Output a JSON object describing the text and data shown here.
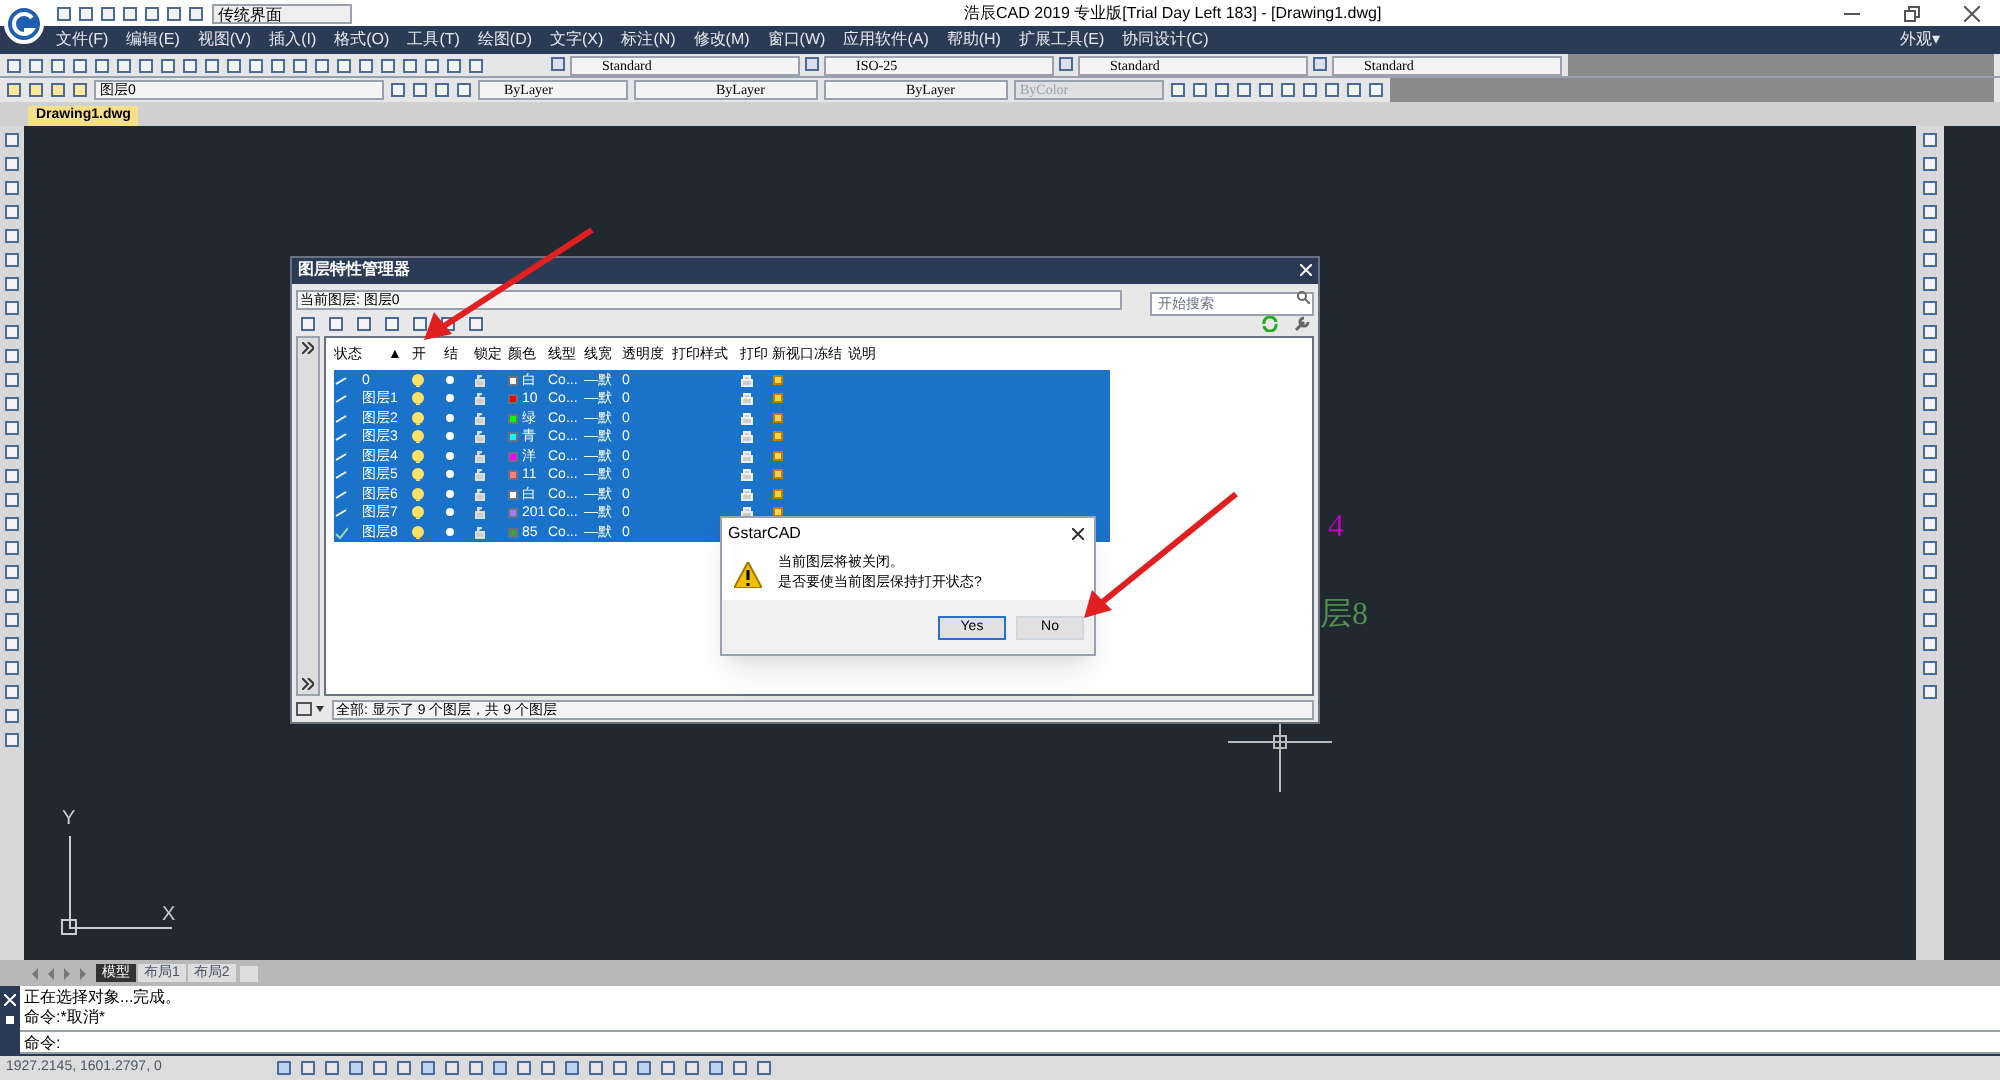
{
  "window": {
    "title": "浩辰CAD 2019 专业版[Trial Day Left 183] - [Drawing1.dwg]",
    "workspace": "传统界面",
    "appearance": "外观▾"
  },
  "menu": [
    "文件(F)",
    "编辑(E)",
    "视图(V)",
    "插入(I)",
    "格式(O)",
    "工具(T)",
    "绘图(D)",
    "文字(X)",
    "标注(N)",
    "修改(M)",
    "窗口(W)",
    "应用软件(A)",
    "帮助(H)",
    "扩展工具(E)",
    "协同设计(C)"
  ],
  "toolbar_dropdowns": [
    "Standard",
    "ISO-25",
    "Standard",
    "Standard"
  ],
  "properties_bar": {
    "layer": "图层0",
    "color_setting": "ByLayer",
    "linetype": "ByLayer",
    "lineweight": "ByLayer",
    "plotstyle": "ByColor"
  },
  "document_tabs": [
    {
      "label": "Drawing1.dwg",
      "selected": true
    }
  ],
  "canvas_texts": [
    {
      "text": "4",
      "color": "#c000c0"
    },
    {
      "text": "层8",
      "color": "#4f8f4f"
    }
  ],
  "ucs_labels": [
    "Y",
    "X"
  ],
  "layout_tabs": [
    {
      "label": "模型",
      "selected": true
    },
    {
      "label": "布局1",
      "selected": false
    },
    {
      "label": "布局2",
      "selected": false
    }
  ],
  "command_history": [
    "正在选择对象...完成。",
    "命令:*取消*"
  ],
  "command_prompt": "命令:",
  "coordinates": "1927.2145, 1601.2797, 0",
  "layer_manager": {
    "title": "图层特性管理器",
    "current_layer": "当前图层: 图层0",
    "search_placeholder": "开始搜索",
    "columns": [
      "状态",
      "▲",
      "开",
      "结",
      "锁定",
      "颜色",
      "线型",
      "线宽",
      "透明度",
      "打印样式",
      "打印",
      "新视口冻结",
      "说明"
    ],
    "rows": [
      {
        "current": false,
        "name": "0",
        "on": true,
        "color": "#ffffff",
        "color_name": "白",
        "linetype": "Co...",
        "lineweight": "—默",
        "transparency": "0",
        "selected": true
      },
      {
        "current": false,
        "name": "图层1",
        "on": true,
        "color": "#ff0000",
        "color_name": "10",
        "linetype": "Co...",
        "lineweight": "—默",
        "transparency": "0",
        "selected": true
      },
      {
        "current": false,
        "name": "图层2",
        "on": true,
        "color": "#00ff00",
        "color_name": "绿",
        "linetype": "Co...",
        "lineweight": "—默",
        "transparency": "0",
        "selected": true
      },
      {
        "current": false,
        "name": "图层3",
        "on": true,
        "color": "#00ffff",
        "color_name": "青",
        "linetype": "Co...",
        "lineweight": "—默",
        "transparency": "0",
        "selected": true
      },
      {
        "current": false,
        "name": "图层4",
        "on": true,
        "color": "#ff00ff",
        "color_name": "洋",
        "linetype": "Co...",
        "lineweight": "—默",
        "transparency": "0",
        "selected": true
      },
      {
        "current": false,
        "name": "图层5",
        "on": true,
        "color": "#ff7f7f",
        "color_name": "11",
        "linetype": "Co...",
        "lineweight": "—默",
        "transparency": "0",
        "selected": true
      },
      {
        "current": false,
        "name": "图层6",
        "on": true,
        "color": "#ffffff",
        "color_name": "白",
        "linetype": "Co...",
        "lineweight": "—默",
        "transparency": "0",
        "selected": true
      },
      {
        "current": false,
        "name": "图层7",
        "on": true,
        "color": "#9f7fff",
        "color_name": "201",
        "linetype": "Co...",
        "lineweight": "—默",
        "transparency": "0",
        "selected": true
      },
      {
        "current": true,
        "name": "图层8",
        "on": true,
        "color": "#3f9f3f",
        "color_name": "85",
        "linetype": "Co...",
        "lineweight": "—默",
        "transparency": "0",
        "selected": true
      }
    ],
    "summary": "全部: 显示了 9 个图层，共 9 个图层"
  },
  "message_box": {
    "title": "GstarCAD",
    "lines": [
      "当前图层将被关闭。",
      "是否要使当前图层保持打开状态?"
    ],
    "buttons": [
      {
        "label": "Yes",
        "selected": true
      },
      {
        "label": "No",
        "selected": false
      }
    ]
  }
}
